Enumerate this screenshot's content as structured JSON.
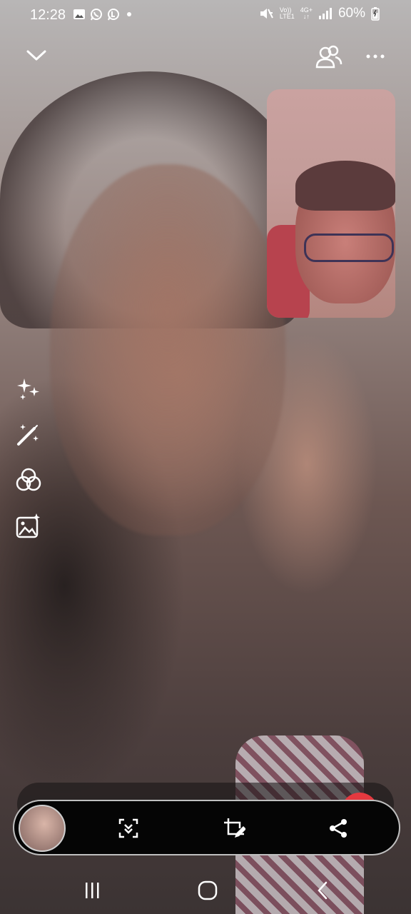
{
  "status_bar": {
    "time": "12:28",
    "left_icons": [
      "gallery-icon",
      "whatsapp-icon",
      "whatsapp-business-icon",
      "notification-dot"
    ],
    "right_icons": [
      "mute-icon",
      "volte-icon",
      "network-4g-icon",
      "signal-icon"
    ],
    "network_line1": "Vo))",
    "network_line2": "LTE1",
    "network_type": "4G+",
    "battery_percent": "60%"
  },
  "call": {
    "top_controls": [
      "minimize-icon",
      "participants-icon",
      "more-options-icon"
    ],
    "effect_tools": [
      "ai-sparkle-icon",
      "magic-wand-icon",
      "color-filter-icon",
      "background-image-icon"
    ]
  },
  "toolbar": {
    "buttons": [
      "screenshot-thumbnail",
      "scroll-capture-icon",
      "crop-edit-icon",
      "share-icon"
    ],
    "accent_color": "#e4393f"
  },
  "nav_bar": {
    "buttons": [
      "recent-apps-icon",
      "home-icon",
      "back-icon"
    ]
  }
}
